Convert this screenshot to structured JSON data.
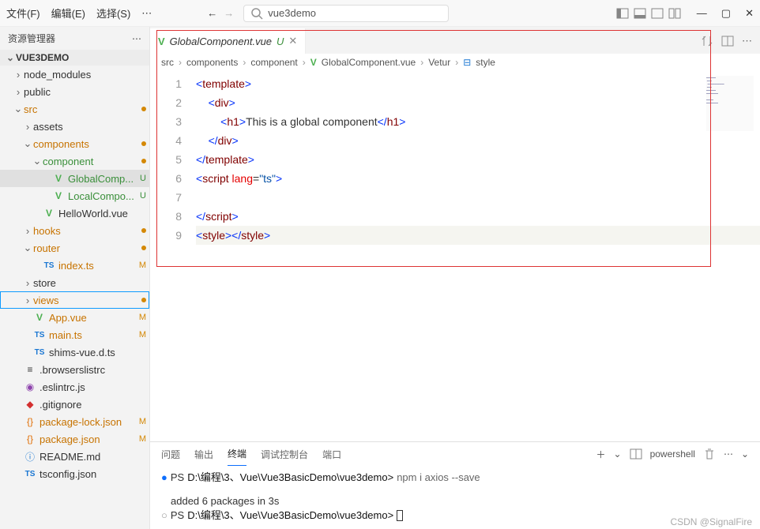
{
  "menus": {
    "file": "文件(F)",
    "edit": "编辑(E)",
    "select": "选择(S)"
  },
  "search": {
    "placeholder": "vue3demo"
  },
  "explorer": {
    "title": "资源管理器",
    "project": "VUE3DEMO"
  },
  "tree": [
    {
      "depth": 1,
      "kind": "folder",
      "expanded": false,
      "label": "node_modules",
      "cls": "",
      "badge": ""
    },
    {
      "depth": 1,
      "kind": "folder",
      "expanded": false,
      "label": "public",
      "cls": "",
      "badge": ""
    },
    {
      "depth": 1,
      "kind": "folder",
      "expanded": true,
      "label": "src",
      "cls": "name-orange",
      "badge": "dot"
    },
    {
      "depth": 2,
      "kind": "folder",
      "expanded": false,
      "label": "assets",
      "cls": "",
      "badge": ""
    },
    {
      "depth": 2,
      "kind": "folder",
      "expanded": true,
      "label": "components",
      "cls": "name-orange",
      "badge": "dot"
    },
    {
      "depth": 3,
      "kind": "folder",
      "expanded": true,
      "label": "component",
      "cls": "name-green",
      "badge": "dot"
    },
    {
      "depth": 4,
      "kind": "file",
      "icon": "V",
      "iconCls": "ic-green",
      "label": "GlobalComp...",
      "cls": "name-green",
      "badge": "U",
      "selected": true
    },
    {
      "depth": 4,
      "kind": "file",
      "icon": "V",
      "iconCls": "ic-green",
      "label": "LocalCompo...",
      "cls": "name-green",
      "badge": "U"
    },
    {
      "depth": 3,
      "kind": "file",
      "icon": "V",
      "iconCls": "ic-green",
      "label": "HelloWorld.vue",
      "cls": "",
      "badge": ""
    },
    {
      "depth": 2,
      "kind": "folder",
      "expanded": false,
      "label": "hooks",
      "cls": "name-orange",
      "badge": "dot"
    },
    {
      "depth": 2,
      "kind": "folder",
      "expanded": true,
      "label": "router",
      "cls": "name-orange",
      "badge": "dot"
    },
    {
      "depth": 3,
      "kind": "file",
      "icon": "TS",
      "iconCls": "ic-blue",
      "label": "index.ts",
      "cls": "name-orange",
      "badge": "M"
    },
    {
      "depth": 2,
      "kind": "folder",
      "expanded": false,
      "label": "store",
      "cls": "",
      "badge": ""
    },
    {
      "depth": 2,
      "kind": "folder",
      "expanded": false,
      "label": "views",
      "cls": "name-orange",
      "badge": "dot",
      "outlined": true
    },
    {
      "depth": 2,
      "kind": "file",
      "icon": "V",
      "iconCls": "ic-green",
      "label": "App.vue",
      "cls": "name-orange",
      "badge": "M"
    },
    {
      "depth": 2,
      "kind": "file",
      "icon": "TS",
      "iconCls": "ic-blue",
      "label": "main.ts",
      "cls": "name-orange",
      "badge": "M"
    },
    {
      "depth": 2,
      "kind": "file",
      "icon": "TS",
      "iconCls": "ic-blue",
      "label": "shims-vue.d.ts",
      "cls": "",
      "badge": ""
    },
    {
      "depth": 1,
      "kind": "file",
      "icon": "≡",
      "iconCls": "",
      "label": ".browserslistrc",
      "cls": "",
      "badge": ""
    },
    {
      "depth": 1,
      "kind": "file",
      "icon": "◉",
      "iconCls": "ic-purple",
      "label": ".eslintrc.js",
      "cls": "",
      "badge": ""
    },
    {
      "depth": 1,
      "kind": "file",
      "icon": "◆",
      "iconCls": "ic-red",
      "label": ".gitignore",
      "cls": "",
      "badge": ""
    },
    {
      "depth": 1,
      "kind": "file",
      "icon": "{}",
      "iconCls": "ic-orange",
      "label": "package-lock.json",
      "cls": "name-orange",
      "badge": "M"
    },
    {
      "depth": 1,
      "kind": "file",
      "icon": "{}",
      "iconCls": "ic-orange",
      "label": "package.json",
      "cls": "name-orange",
      "badge": "M"
    },
    {
      "depth": 1,
      "kind": "file",
      "icon": "ⓘ",
      "iconCls": "ic-info",
      "label": "README.md",
      "cls": "",
      "badge": ""
    },
    {
      "depth": 1,
      "kind": "file",
      "icon": "TS",
      "iconCls": "ic-blue",
      "label": "tsconfig.json",
      "cls": "",
      "badge": ""
    }
  ],
  "tab": {
    "icon": "V",
    "label": "GlobalComponent.vue",
    "git": "U"
  },
  "breadcrumb": [
    "src",
    "components",
    "component",
    "GlobalComponent.vue",
    "Vetur",
    "style"
  ],
  "code": {
    "lines": [
      1,
      2,
      3,
      4,
      5,
      6,
      7,
      8,
      9
    ],
    "current": 9
  },
  "terminal": {
    "tabs": [
      "问题",
      "输出",
      "终端",
      "调试控制台",
      "端口"
    ],
    "activeTab": 2,
    "shell": "powershell",
    "line1_prefix": "PS ",
    "line1_path": "D:\\编程\\3、Vue\\Vue3BasicDemo\\vue3demo>",
    "line1_cmd": " npm i axios --save",
    "line2": "added 6 packages in 3s",
    "line3_prefix": "PS ",
    "line3_path": "D:\\编程\\3、Vue\\Vue3BasicDemo\\vue3demo>"
  },
  "watermark": "CSDN @SignalFire"
}
